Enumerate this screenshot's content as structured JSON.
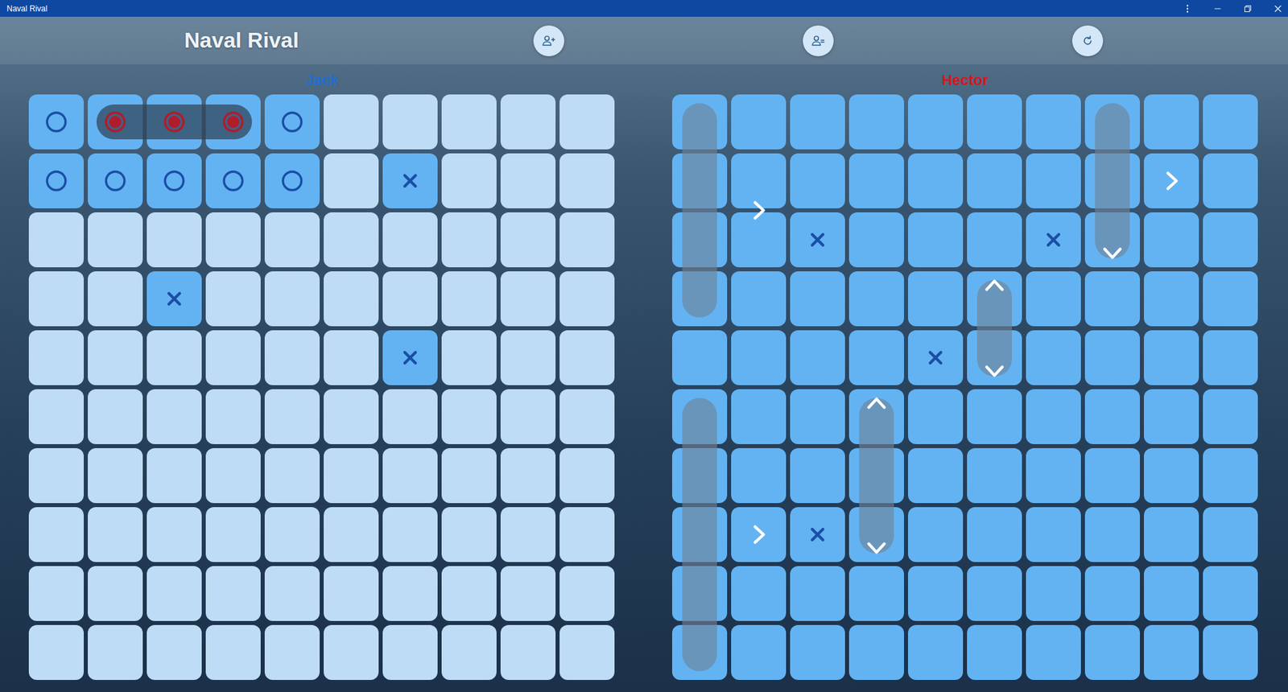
{
  "window": {
    "title": "Naval Rival"
  },
  "header": {
    "title": "Naval Rival"
  },
  "boards": [
    {
      "player": "Jack",
      "color": "#1f6fd1",
      "revealed": false,
      "ships": [
        {
          "row": 0,
          "col": 1,
          "length": 3,
          "vertical": false,
          "sunk": true,
          "handles": []
        }
      ],
      "marks": [
        {
          "row": 0,
          "col": 0,
          "kind": "miss"
        },
        {
          "row": 0,
          "col": 1,
          "kind": "hit"
        },
        {
          "row": 0,
          "col": 2,
          "kind": "hit"
        },
        {
          "row": 0,
          "col": 3,
          "kind": "hit"
        },
        {
          "row": 0,
          "col": 4,
          "kind": "miss"
        },
        {
          "row": 1,
          "col": 0,
          "kind": "miss"
        },
        {
          "row": 1,
          "col": 1,
          "kind": "miss"
        },
        {
          "row": 1,
          "col": 2,
          "kind": "miss"
        },
        {
          "row": 1,
          "col": 3,
          "kind": "miss"
        },
        {
          "row": 1,
          "col": 4,
          "kind": "miss"
        },
        {
          "row": 1,
          "col": 6,
          "kind": "cross"
        },
        {
          "row": 3,
          "col": 2,
          "kind": "cross"
        },
        {
          "row": 4,
          "col": 6,
          "kind": "cross"
        }
      ]
    },
    {
      "player": "Hector",
      "color": "#d0191f",
      "revealed": true,
      "ships": [
        {
          "row": 0,
          "col": 0,
          "length": 4,
          "vertical": true,
          "sunk": false,
          "handles": [
            "right"
          ]
        },
        {
          "row": 0,
          "col": 7,
          "length": 3,
          "vertical": true,
          "sunk": false,
          "handles": [
            "right",
            "down"
          ]
        },
        {
          "row": 5,
          "col": 0,
          "length": 5,
          "vertical": true,
          "sunk": false,
          "handles": [
            "right"
          ]
        },
        {
          "row": 3,
          "col": 5,
          "length": 2,
          "vertical": true,
          "sunk": false,
          "handles": [
            "up",
            "down"
          ]
        },
        {
          "row": 5,
          "col": 3,
          "length": 3,
          "vertical": true,
          "sunk": false,
          "handles": [
            "up",
            "down"
          ]
        }
      ],
      "marks": [
        {
          "row": 2,
          "col": 2,
          "kind": "cross"
        },
        {
          "row": 2,
          "col": 6,
          "kind": "cross"
        },
        {
          "row": 4,
          "col": 4,
          "kind": "cross"
        },
        {
          "row": 7,
          "col": 2,
          "kind": "cross"
        }
      ]
    }
  ]
}
